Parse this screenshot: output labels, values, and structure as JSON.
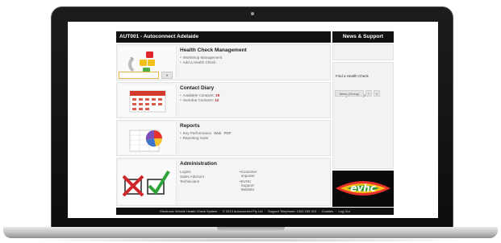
{
  "header": {
    "title": "AUT001 - Autoconnect Adelaide"
  },
  "side": {
    "title": "News & Support",
    "find_label": "Find a Health Check",
    "find_button": "»",
    "weekly_label": "Weekly Email Report",
    "weekly_button_1": "Items (Group)",
    "weekly_button_2": "?",
    "weekly_button_3": "»"
  },
  "cards": {
    "health": {
      "title": "Health Check Management",
      "items": [
        "Workshop Management",
        "Add a Health Check"
      ]
    },
    "contact": {
      "title": "Contact Diary",
      "available_label": "Available Contacts:",
      "available_count": "15",
      "overdue_label": "Overdue Contacts:",
      "overdue_count": "12"
    },
    "reports": {
      "title": "Reports",
      "kpi_label": "Key Performance",
      "kpi_web": "Web",
      "kpi_pdf": "PDF",
      "suite": "Reporting Suite"
    },
    "admin": {
      "title": "Administration",
      "logins": "Logins",
      "sales": "Sales Advisors",
      "techs": "Technicians",
      "importer": "Customer Importer",
      "website": "EVHC Support Website"
    }
  },
  "logo": {
    "text": "evhc"
  },
  "footer": {
    "system": "Electronic Vehicle Health Check System",
    "copyright": "© 2013 Autoconnect Pty Ltd",
    "support": "Support Telephone: 1300 235 913",
    "cookies": "Cookies",
    "logout": "Log Out"
  },
  "colors": {
    "accent_red": "#b81f1f",
    "input_border": "#e7b54a",
    "header_bg": "#111111"
  }
}
